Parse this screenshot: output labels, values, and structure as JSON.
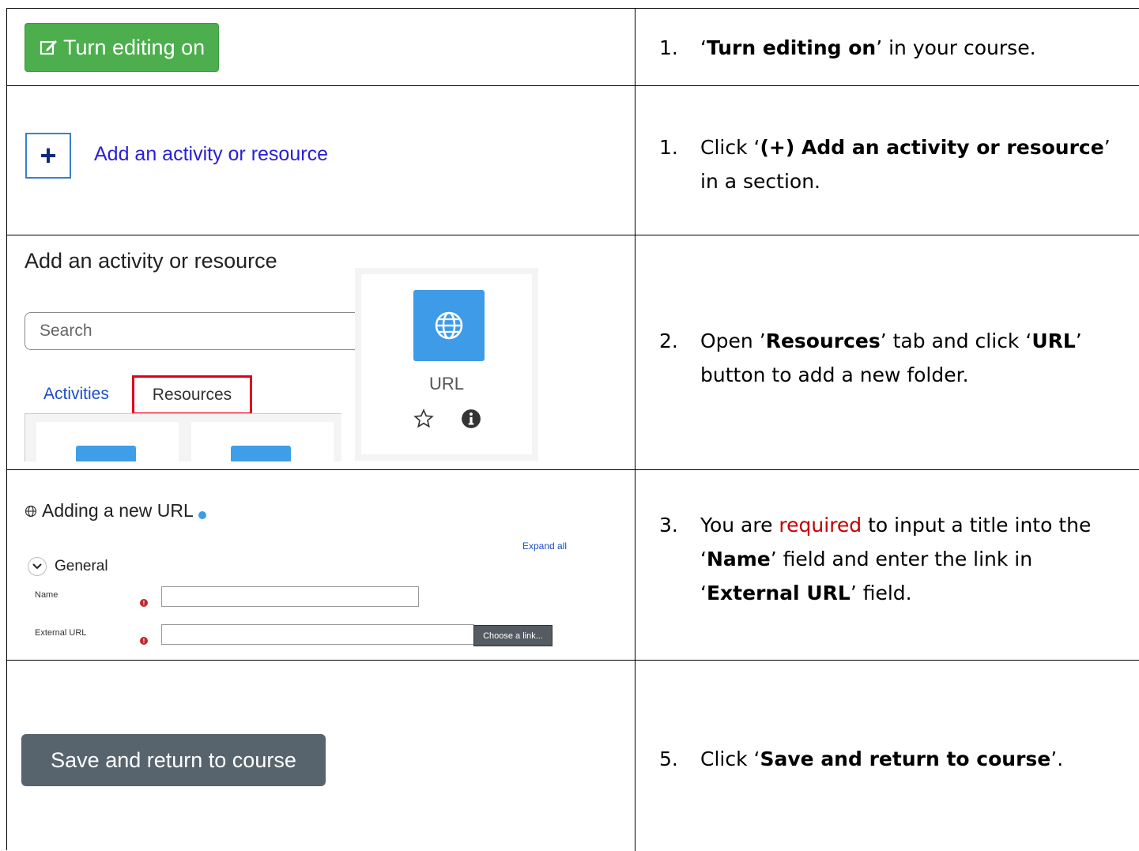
{
  "rows": [
    {
      "button_label": "Turn editing on",
      "num": "1.",
      "bold": "Turn editing on",
      "after": " in your course."
    },
    {
      "link_label": "Add an activity or resource",
      "num": "1.",
      "pre": "Click ",
      "bold": "(+) Add an activity or resource",
      "after": " in a section."
    },
    {
      "dialog_title": "Add an activity or resource",
      "search_placeholder": "Search",
      "tab_activities": "Activities",
      "tab_resources": "Resources",
      "url_label": "URL",
      "num": "2.",
      "pre": "Open ",
      "bold1": "Resources",
      "mid": " tab and click ",
      "bold2": "URL",
      "after": " button to add a new folder."
    },
    {
      "form_title": "Adding a new URL",
      "expand_all": "Expand all",
      "section": "General",
      "name_label": "Name",
      "url_field_label": "External URL",
      "choose_link": "Choose a link...",
      "num": "3.",
      "pre": "You are ",
      "req": "required",
      "mid1": " to input a title into the ",
      "bold1": "Name",
      "mid2": " field and enter the link in ",
      "bold2": "External URL",
      "after": " field."
    },
    {
      "save_label": "Save and return to course",
      "num": "5.",
      "pre": "Click ",
      "bold": "Save and return to course",
      "after": "."
    }
  ],
  "colors": {
    "green_button": "#4cae4c",
    "blue_icon": "#3d9be8",
    "red_highlight": "#e0001b",
    "required_text": "#c00000",
    "save_button": "#58646d"
  }
}
